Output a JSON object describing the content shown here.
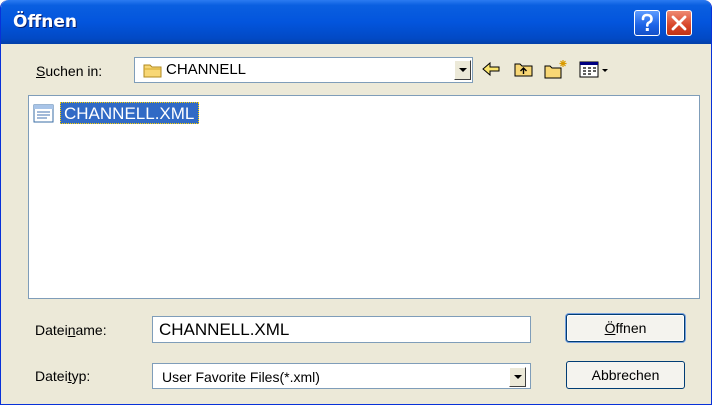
{
  "window": {
    "title": "Öffnen",
    "help_icon": "question-icon",
    "close_icon": "close-icon"
  },
  "lookin": {
    "label_pre": "",
    "label_underlined": "S",
    "label_post": "uchen in:",
    "value": "CHANNELL",
    "icon": "folder-icon"
  },
  "toolbar": {
    "back_icon": "back-arrow-icon",
    "up_icon": "up-folder-icon",
    "new_folder_icon": "new-folder-icon",
    "view_icon": "view-menu-icon"
  },
  "files": [
    {
      "name": "CHANNELL.XML",
      "icon": "xml-file-icon",
      "selected": true
    }
  ],
  "filename": {
    "label_pre": "Datei",
    "label_underlined": "n",
    "label_post": "ame:",
    "value": "CHANNELL.XML"
  },
  "filetype": {
    "label_pre": "Datei",
    "label_underlined": "t",
    "label_post": "yp:",
    "value": "User Favorite Files(*.xml)"
  },
  "buttons": {
    "open_pre": "",
    "open_underlined": "Ö",
    "open_post": "ffnen",
    "cancel": "Abbrechen"
  },
  "colors": {
    "titlebar": "#0355dd",
    "dialog_bg": "#ece9d8",
    "selection": "#316ac5"
  }
}
